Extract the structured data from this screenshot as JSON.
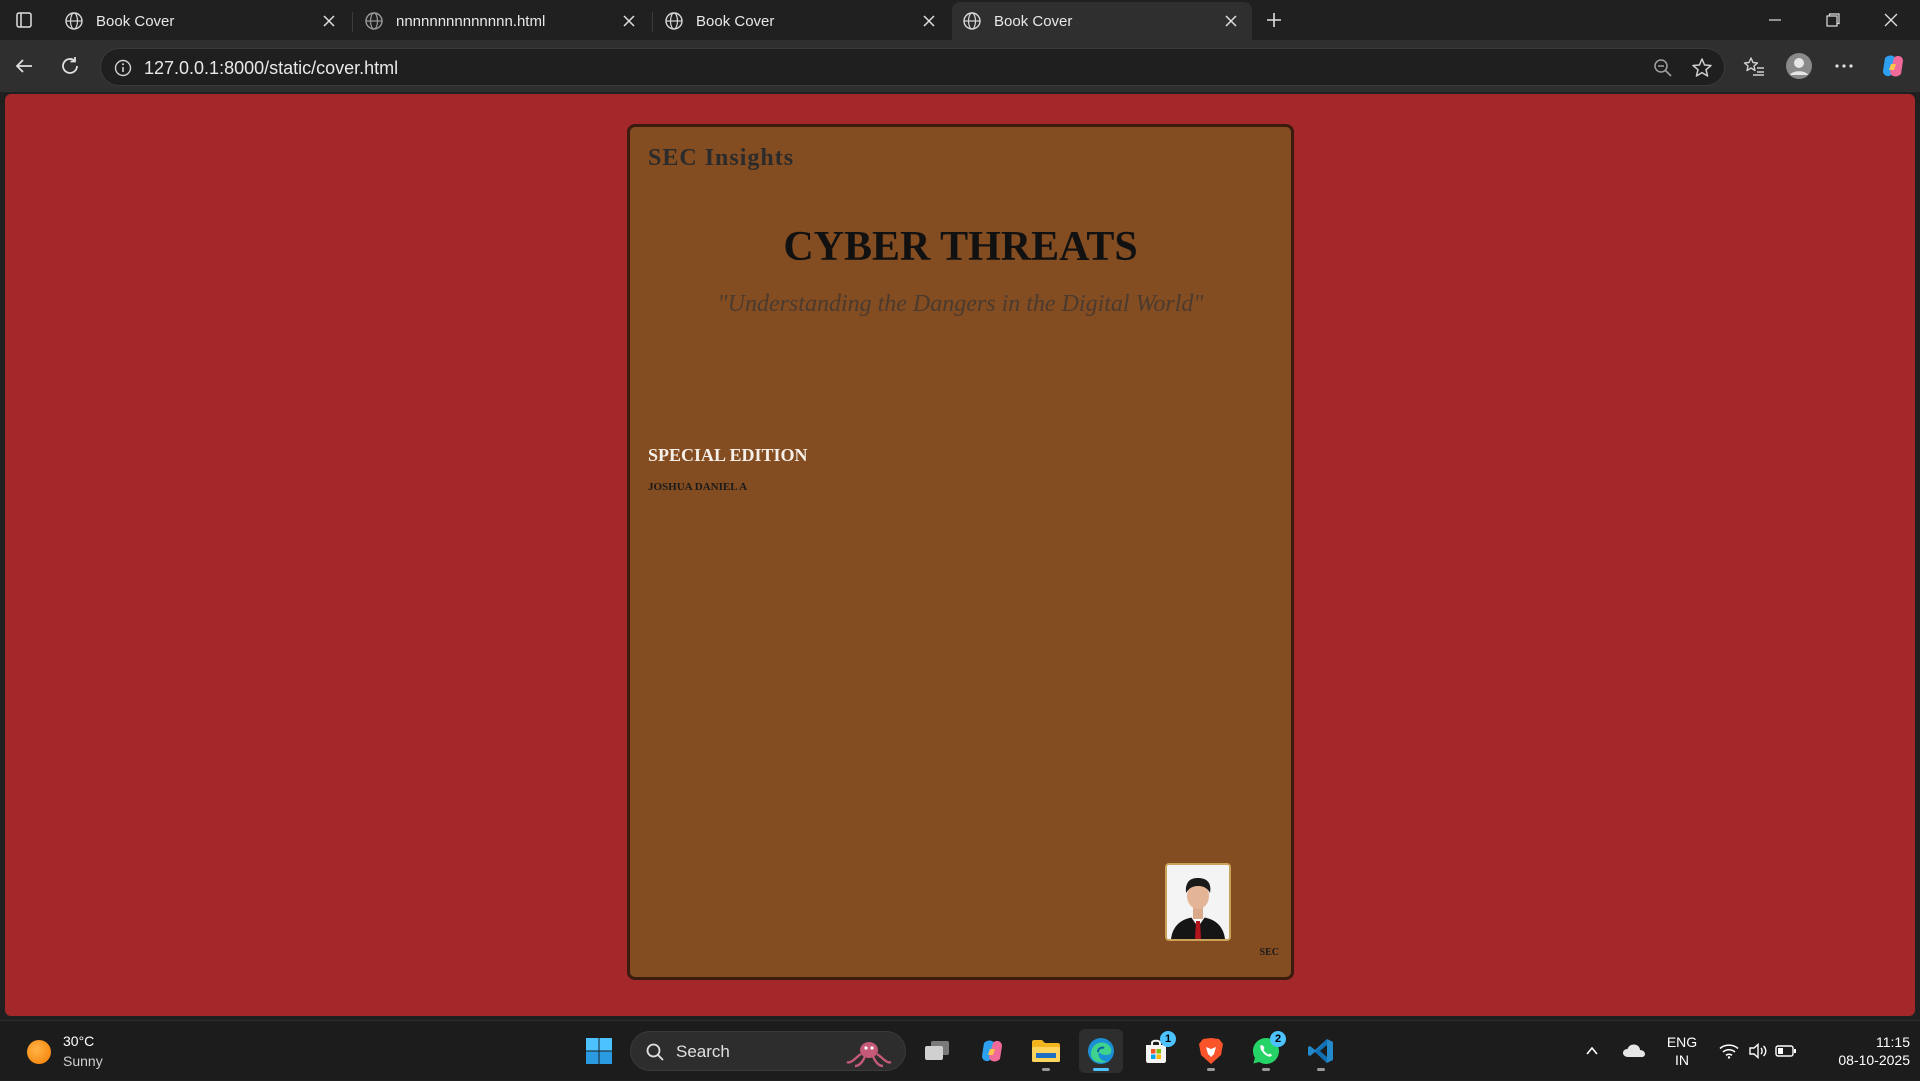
{
  "browser": {
    "tabs": [
      {
        "title": "Book Cover",
        "active": false
      },
      {
        "title": "nnnnnnnnnnnnnn.html",
        "active": false
      },
      {
        "title": "Book Cover",
        "active": false
      },
      {
        "title": "Book Cover",
        "active": true
      }
    ],
    "url": "127.0.0.1:8000/static/cover.html"
  },
  "cover": {
    "publisher": "SEC Insights",
    "title": "CYBER THREATS",
    "tagline": "\"Understanding the Dangers in the Digital World\"",
    "edition": "SPECIAL EDITION",
    "author": "JOSHUA DANIEL A",
    "brand": "SEC",
    "colors": {
      "page_bg": "#a4282a",
      "cover_bg": "#834c21",
      "cover_border": "#3a1b0e"
    }
  },
  "taskbar": {
    "weather": {
      "temp": "30°C",
      "condition": "Sunny"
    },
    "search_label": "Search",
    "badges": {
      "store": "1",
      "whatsapp": "2"
    },
    "lang": {
      "line1": "ENG",
      "line2": "IN"
    },
    "clock": {
      "time": "11:15",
      "date": "08-10-2025"
    }
  }
}
